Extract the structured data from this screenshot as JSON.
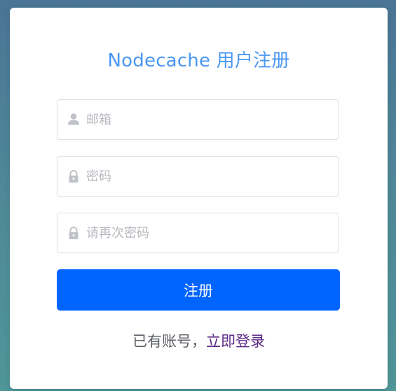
{
  "form": {
    "title": "Nodecache 用户注册",
    "fields": [
      {
        "icon": "user-icon",
        "placeholder": "邮箱",
        "value": ""
      },
      {
        "icon": "lock-icon",
        "placeholder": "密码",
        "value": ""
      },
      {
        "icon": "lock-icon",
        "placeholder": "请再次密码",
        "value": ""
      }
    ],
    "submit_label": "注册",
    "footer_prompt": "已有账号，",
    "login_link": "立即登录"
  },
  "colors": {
    "accent": "#4a97f3",
    "button": "#0064ff",
    "link": "#5b2a86"
  }
}
